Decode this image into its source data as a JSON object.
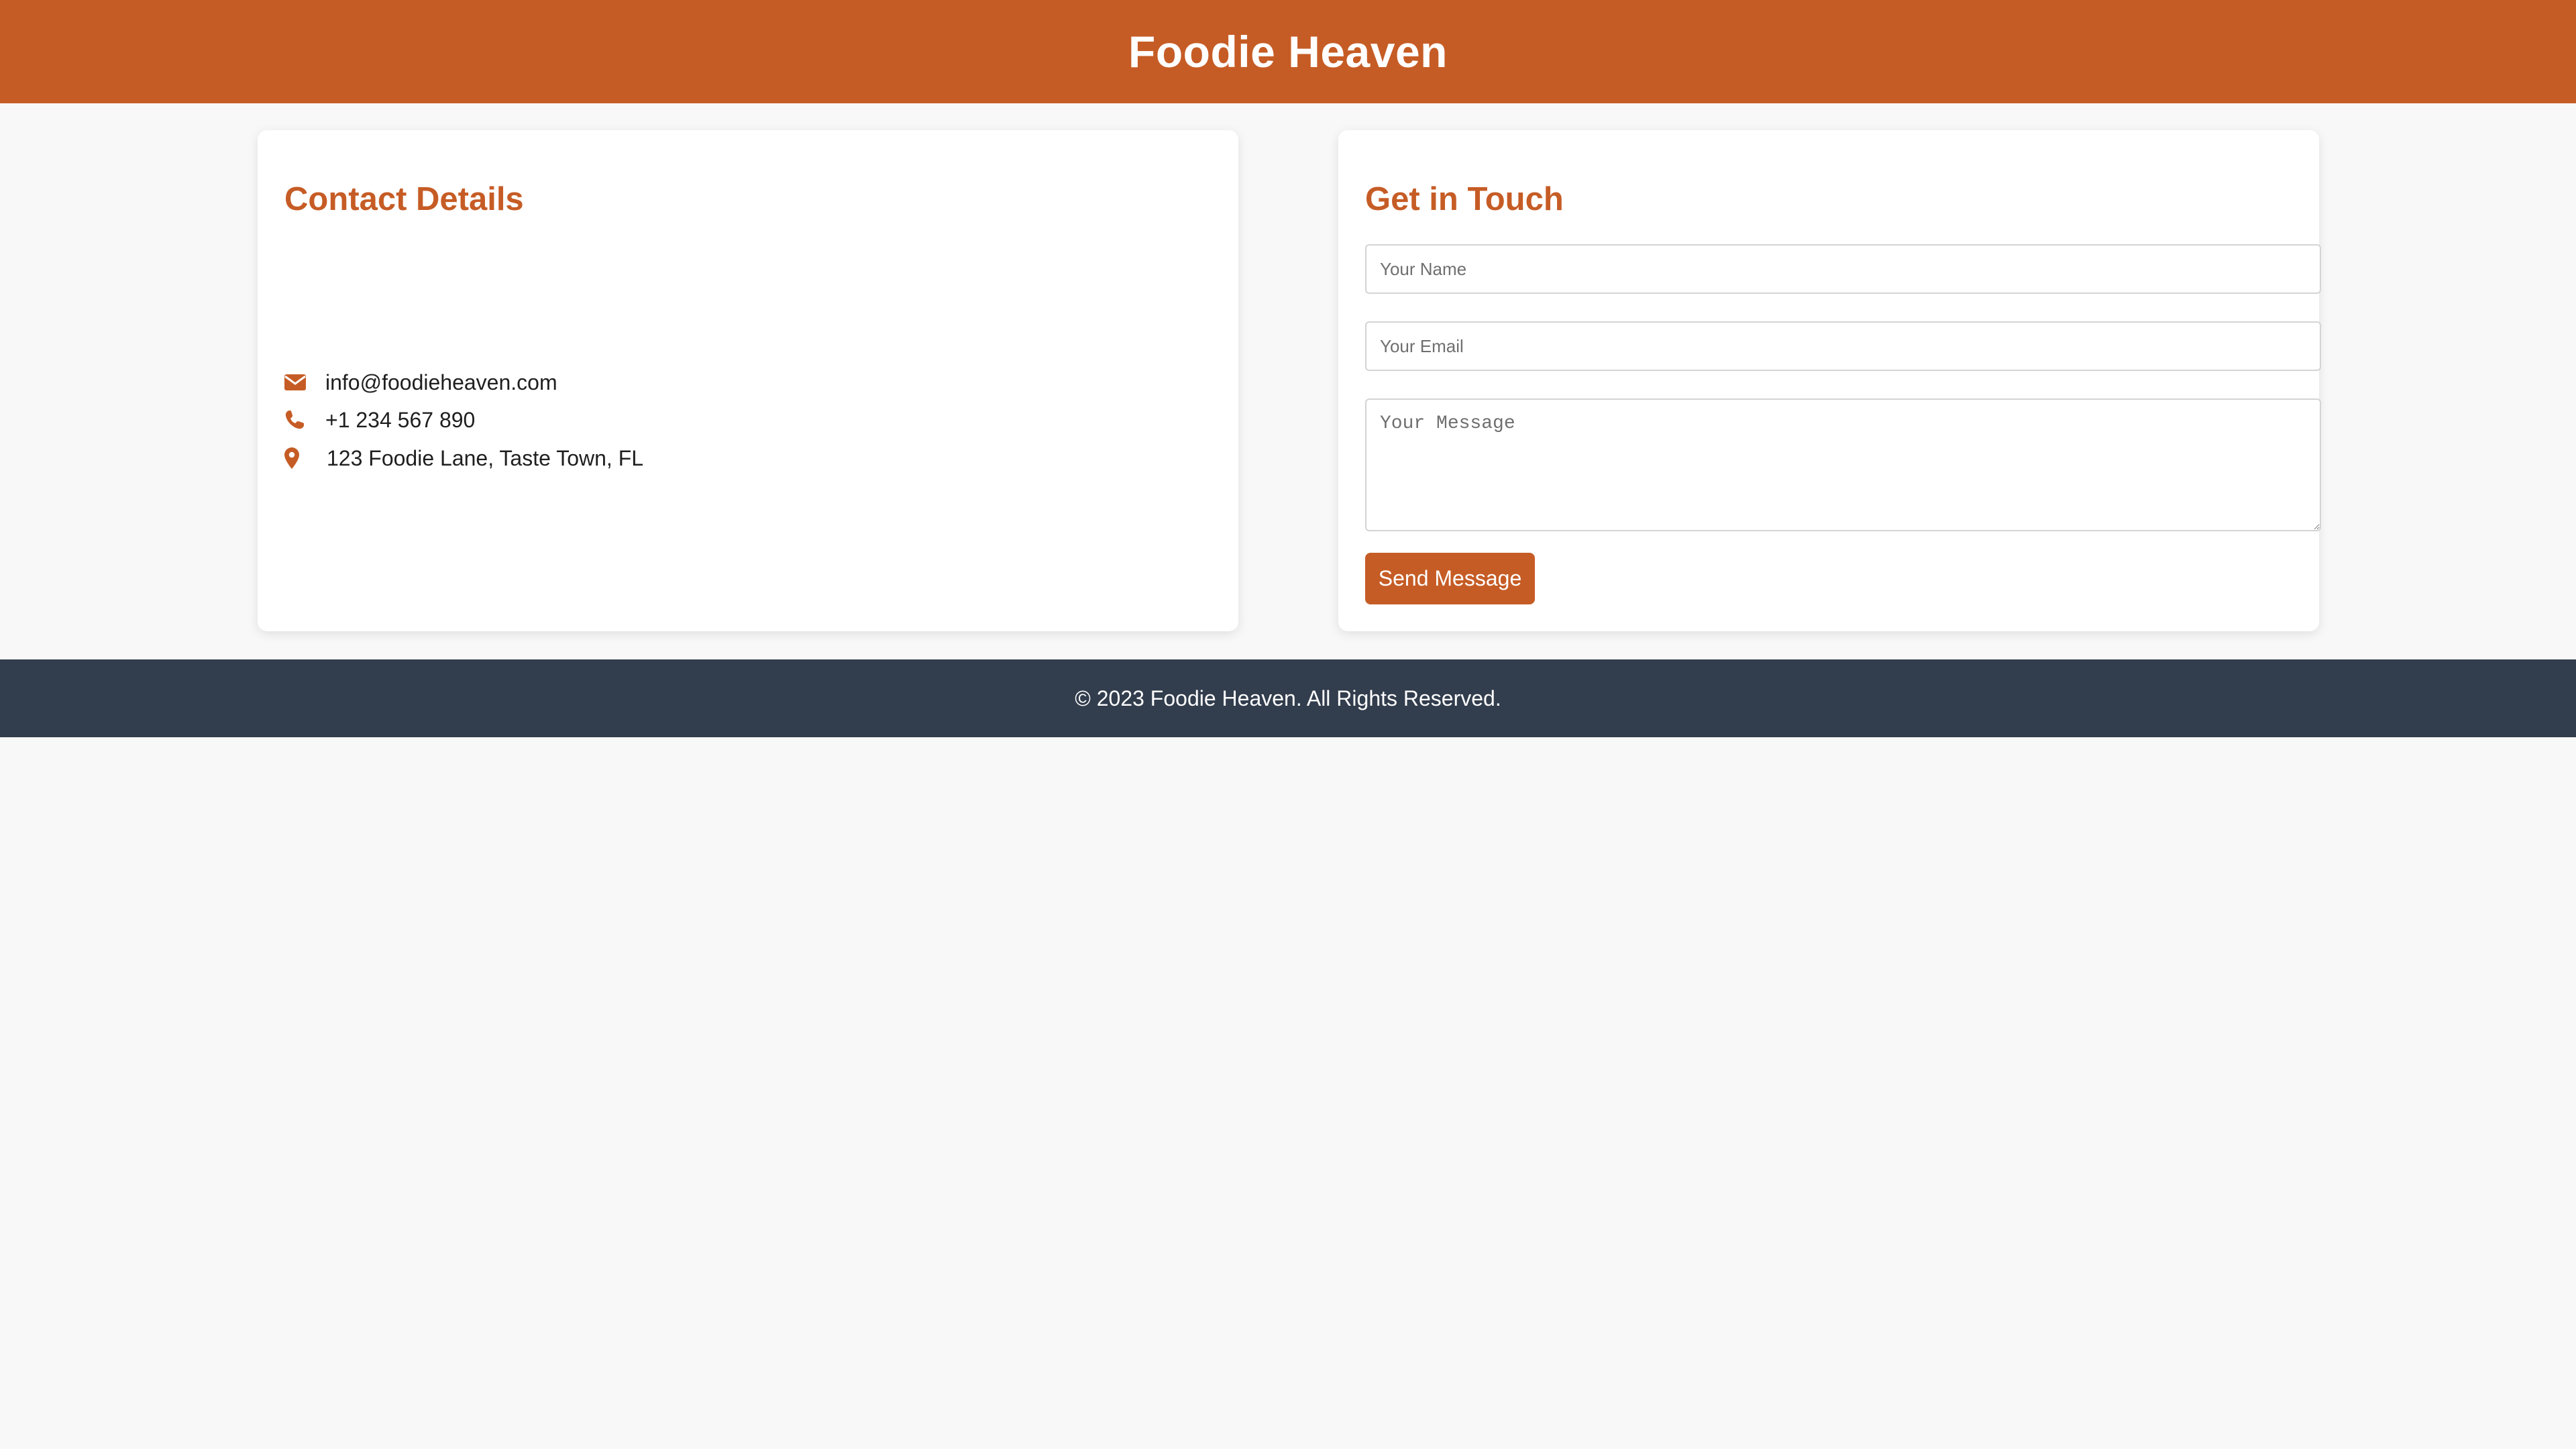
{
  "header": {
    "title": "Foodie Heaven"
  },
  "contact": {
    "heading": "Contact Details",
    "items": [
      {
        "icon": "envelope-icon",
        "text": "info@foodieheaven.com"
      },
      {
        "icon": "phone-icon",
        "text": "+1 234 567 890"
      },
      {
        "icon": "map-marker-icon",
        "text": "123 Foodie Lane, Taste Town, FL"
      }
    ]
  },
  "form": {
    "heading": "Get in Touch",
    "name_placeholder": "Your Name",
    "name_value": "",
    "email_placeholder": "Your Email",
    "email_value": "",
    "message_placeholder": "Your Message",
    "message_value": "",
    "submit_label": "Send Message"
  },
  "footer": {
    "text": "© 2023 Foodie Heaven. All Rights Reserved."
  },
  "colors": {
    "brand": "#c65c25",
    "footer_bg": "#323d4d",
    "page_bg": "#f8f8f8"
  }
}
